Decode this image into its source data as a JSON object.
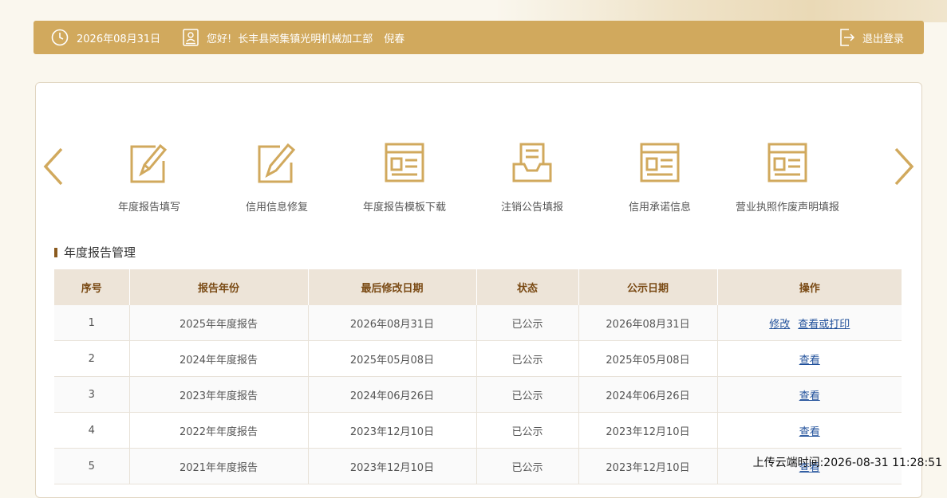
{
  "header": {
    "date": "2026年08月31日",
    "greeting": "您好!",
    "company": "长丰县岗集镇光明机械加工部",
    "person": "倪春",
    "logout": "退出登录"
  },
  "functions": [
    {
      "label": "年度报告填写",
      "icon": "edit-form-icon"
    },
    {
      "label": "信用信息修复",
      "icon": "edit-pen-icon"
    },
    {
      "label": "年度报告模板下载",
      "icon": "document-template-icon"
    },
    {
      "label": "注销公告填报",
      "icon": "inbox-tray-icon"
    },
    {
      "label": "信用承诺信息",
      "icon": "document-list-icon"
    },
    {
      "label": "营业执照作废声明填报",
      "icon": "document-list-icon"
    }
  ],
  "section": {
    "title": "年度报告管理"
  },
  "table": {
    "headers": [
      "序号",
      "报告年份",
      "最后修改日期",
      "状态",
      "公示日期",
      "操作"
    ],
    "rows": [
      {
        "no": "1",
        "year": "2025年年度报告",
        "modified": "2026年08月31日",
        "status": "已公示",
        "published": "2026年08月31日",
        "actions": [
          "修改",
          "查看或打印"
        ]
      },
      {
        "no": "2",
        "year": "2024年年度报告",
        "modified": "2025年05月08日",
        "status": "已公示",
        "published": "2025年05月08日",
        "actions": [
          "查看"
        ]
      },
      {
        "no": "3",
        "year": "2023年年度报告",
        "modified": "2024年06月26日",
        "status": "已公示",
        "published": "2024年06月26日",
        "actions": [
          "查看"
        ]
      },
      {
        "no": "4",
        "year": "2022年年度报告",
        "modified": "2023年12月10日",
        "status": "已公示",
        "published": "2023年12月10日",
        "actions": [
          "查看"
        ]
      },
      {
        "no": "5",
        "year": "2021年年度报告",
        "modified": "2023年12月10日",
        "status": "已公示",
        "published": "2023年12月10日",
        "actions": [
          "查看"
        ]
      }
    ]
  },
  "upload_stamp": "上传云端时间:2026-08-31 11:28:51",
  "colors": {
    "accent": "#d1a95d",
    "icon": "#d1a95d",
    "header_text": "#7a4a14",
    "link": "#1f4f9a"
  }
}
